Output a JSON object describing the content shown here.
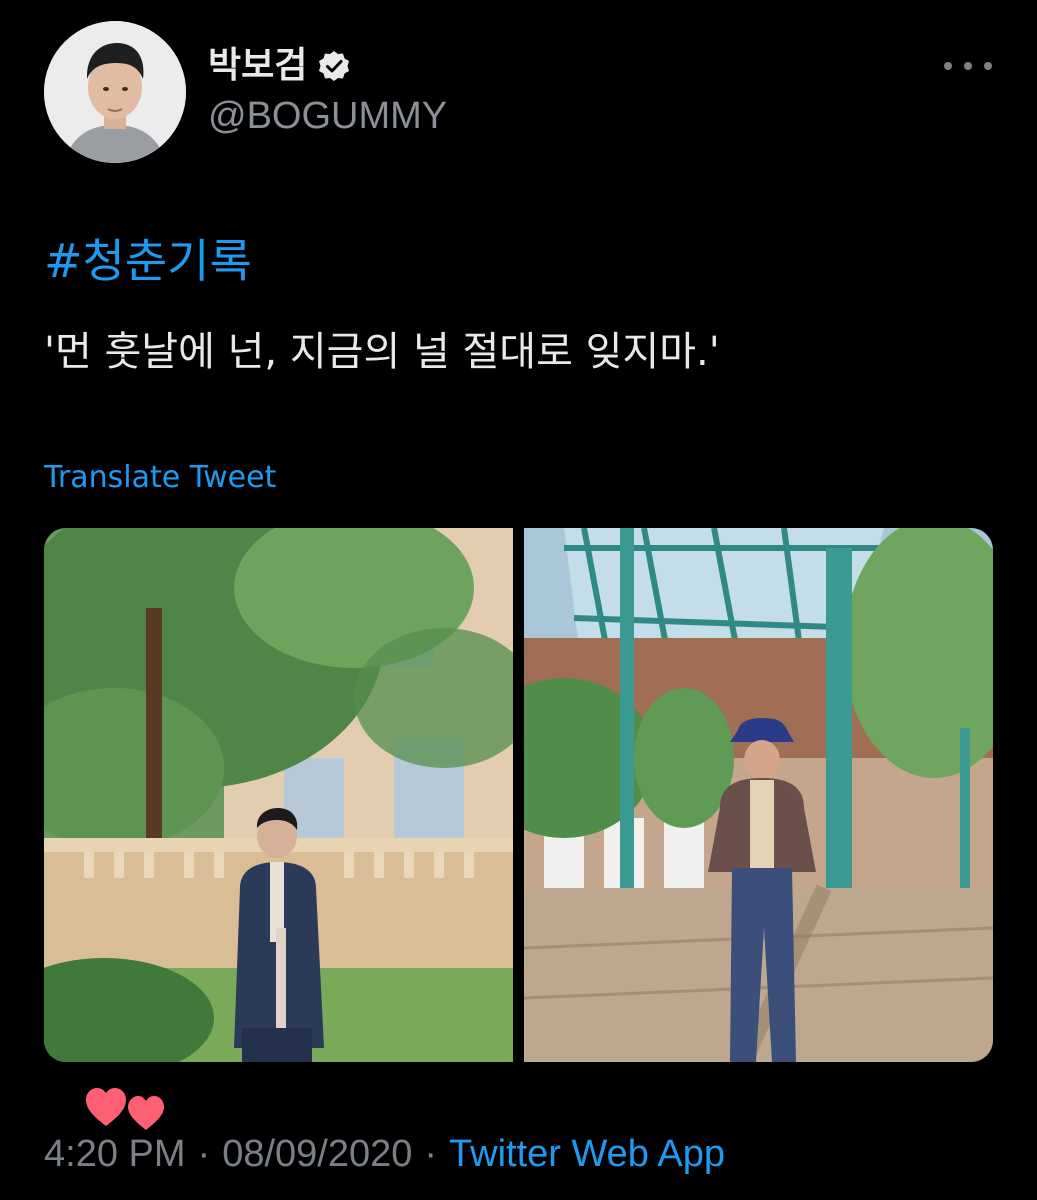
{
  "author": {
    "display_name": "박보검",
    "handle": "@BOGUMMY",
    "verified_icon": "verified-badge-icon"
  },
  "tweet": {
    "hashtag": "#청춘기록",
    "text": "'먼 훗날에 넌, 지금의 널 절대로 잊지마.'",
    "translate_label": "Translate Tweet"
  },
  "media": {
    "photo_count": 2
  },
  "meta": {
    "time": "4:20 PM",
    "separator": "·",
    "date": "08/09/2020",
    "source": "Twitter Web App"
  },
  "colors": {
    "background": "#000000",
    "accent": "#1d9bf0",
    "muted_text": "#7b8087",
    "primary_text": "#e7e9ea",
    "heart": "#ff5f73"
  }
}
